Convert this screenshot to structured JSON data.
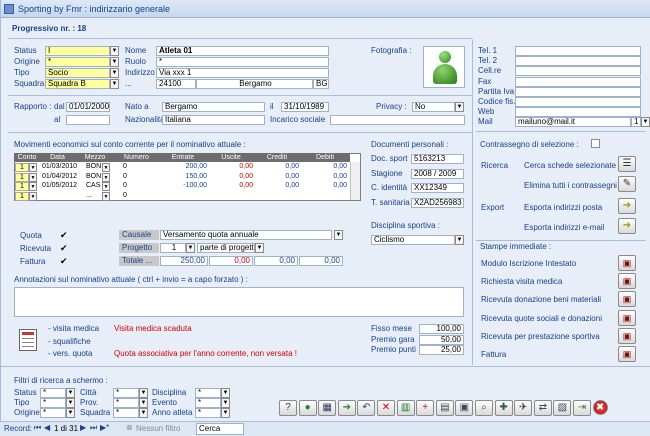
{
  "window": {
    "title": "Sporting by Fmr : indirizzario generale"
  },
  "header": {
    "progressivo": "Progressivo nr. : 18"
  },
  "anagrafica": {
    "status_label": "Status",
    "status_value": "I",
    "origine_label": "Origine",
    "origine_value": "*",
    "tipo_label": "Tipo",
    "tipo_value": "Socio",
    "squadra_label": "Squadra",
    "squadra_value": "Squadra B",
    "nome_label": "Nome",
    "nome_value": "Atleta 01",
    "ruolo_label": "Ruolo",
    "ruolo_value": "*",
    "indirizzo_label": "Indirizzo",
    "indirizzo_value": "Via xxx 1",
    "cap_value": "24100",
    "citta_value": "Bergamo",
    "prov_value": "BG",
    "more_label": "...",
    "fotografia_label": "Fotografia :"
  },
  "contatti": {
    "items": [
      {
        "label": "Tel. 1",
        "value": ""
      },
      {
        "label": "Tel. 2",
        "value": ""
      },
      {
        "label": "Cell.re",
        "value": ""
      },
      {
        "label": "Fax",
        "value": ""
      },
      {
        "label": "Partita Iva",
        "value": ""
      },
      {
        "label": "Codice fis.",
        "value": ""
      },
      {
        "label": "Web",
        "value": ""
      },
      {
        "label": "Mail",
        "value": "mailuno@mail.it"
      }
    ],
    "mail_num": "1"
  },
  "rapporto": {
    "label": "Rapporto :",
    "dal_label": "dal",
    "dal_value": "01/01/2000",
    "al_label": "al",
    "al_value": "",
    "nato_label": "Nato a",
    "nato_value": "Bergamo",
    "il_label": "il",
    "il_value": "31/10/1989",
    "naz_label": "Nazionalità",
    "naz_value": "Italiana",
    "incarico_label": "Incarico sociale",
    "incarico_value": "",
    "privacy_label": "Privacy :",
    "privacy_value": "No"
  },
  "movimenti": {
    "title": "Movimenti economici sul conto corrente per il nominativo attuale :",
    "headers": [
      "Conto",
      "Data",
      "Mezzo",
      "Numero",
      "Entrate",
      "Uscite",
      "Crediti",
      "Debiti"
    ],
    "rows": [
      {
        "conto": "1",
        "data": "01/03/2010",
        "mezzo": "BON",
        "numero": "0",
        "entrate": "200,00",
        "uscite": "0,00",
        "crediti": "0,00",
        "debiti": "0,00"
      },
      {
        "conto": "1",
        "data": "01/04/2012",
        "mezzo": "BON",
        "numero": "0",
        "entrate": "150,00",
        "uscite": "0,00",
        "crediti": "0,00",
        "debiti": "0,00"
      },
      {
        "conto": "1",
        "data": "01/05/2012",
        "mezzo": "CAS",
        "numero": "0",
        "entrate": "-100,00",
        "uscite": "0,00",
        "crediti": "0,00",
        "debiti": "0,00"
      },
      {
        "conto": "1",
        "data": "",
        "mezzo": "...",
        "numero": "0",
        "entrate": "",
        "uscite": "",
        "crediti": "",
        "debiti": ""
      }
    ],
    "quota_label": "Quota",
    "ricevuta_label": "Ricevuta",
    "fattura_label": "Fattura",
    "causale_label": "Causale",
    "causale_value": "Versamento quota annuale",
    "progetto_label": "Progetto",
    "progetto_num": "1",
    "progetto_value": "parte di progetti",
    "totale_label": "Totale ...",
    "totale_value": "250,00",
    "tot_uscite": "0,00",
    "tot_crediti": "0,00",
    "tot_debiti": "0,00"
  },
  "documenti": {
    "title": "Documenti personali :",
    "items": [
      {
        "label": "Doc. sport",
        "value": "5163213"
      },
      {
        "label": "Stagione",
        "value": "2008 / 2009"
      },
      {
        "label": "C. identità",
        "value": "XX12349"
      },
      {
        "label": "T. sanitaria",
        "value": "X2AD256983"
      }
    ],
    "disciplina_label": "Disciplina sportiva :",
    "disciplina_value": "Ciclismo"
  },
  "contrassegno": {
    "title": "Contrassegno di selezione :",
    "ricerca_label": "Ricerca",
    "cerca_label": "Cerca schede selezionate",
    "elimina_label": "Elimina tutti i contrassegni",
    "export_label": "Export",
    "esporta_posta_label": "Esporta indirizzi posta",
    "esporta_email_label": "Esporta indirizzi e-mail"
  },
  "stampe": {
    "title": "Stampe immediate :",
    "items": [
      "Modulo Iscrizione Intestato",
      "Richiesta visita medica",
      "Ricevuta donazione beni materiali",
      "Ricevuta quote sociali e donazioni",
      "Ricevuta per prestazione sportiva",
      "Fattura"
    ]
  },
  "annotazioni": {
    "title": "Annotazioni sul nominativo attuale ( ctrl + invio = a capo forzato ) :",
    "value": ""
  },
  "avvisi": {
    "rows": [
      {
        "label": "- visita medica",
        "value": "Visita medica scaduta"
      },
      {
        "label": "- squalifiche",
        "value": ""
      },
      {
        "label": "- vers. quota",
        "value": "Quota associativa per l'anno corrente, non versata !"
      }
    ]
  },
  "punti": {
    "items": [
      {
        "label": "Fisso mese",
        "value": "100,00"
      },
      {
        "label": "Premio gara",
        "value": "50,00"
      },
      {
        "label": "Premio punti",
        "value": "25,00"
      }
    ]
  },
  "filtri": {
    "title": "Filtri di ricerca a schermo :",
    "status_label": "Status",
    "tipo_label": "Tipo",
    "origine_label": "Origine",
    "citta_label": "Città",
    "prov_label": "Prov.",
    "squadra_label": "Squadra",
    "disciplina_label": "Disciplina",
    "evento_label": "Evento",
    "anno_label": "Anno atleta",
    "star": "*"
  },
  "recordbar": {
    "record_label": "Record:",
    "position": "1 di 31",
    "filter_label": "Nessun filtro",
    "search_placeholder": "Cerca"
  },
  "colors": {
    "accent": "#15428b",
    "warning": "#d40000",
    "bg": "#e8eef8"
  }
}
